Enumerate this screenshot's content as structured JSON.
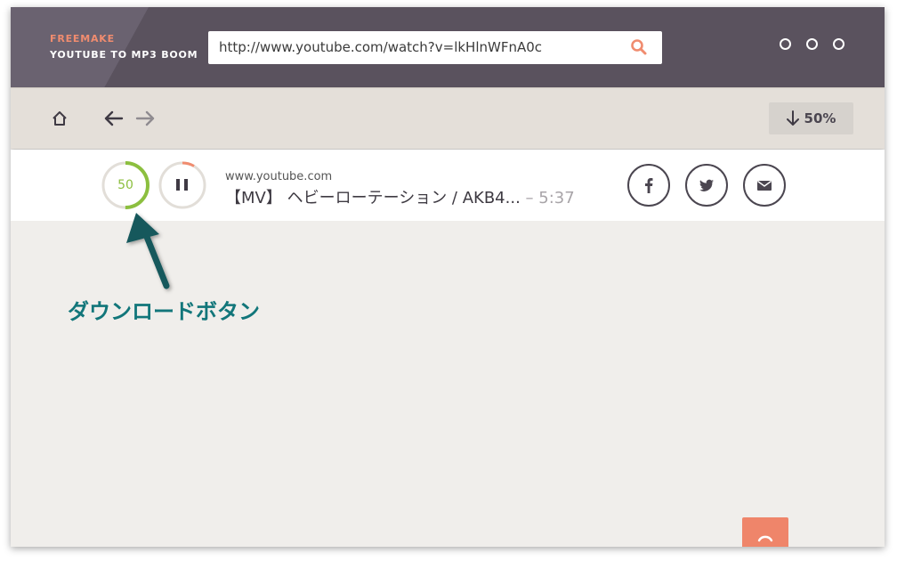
{
  "app": {
    "brand_top": "FREEMAKE",
    "brand_bottom": "YOUTUBE TO MP3 BOOM"
  },
  "search": {
    "url": "http://www.youtube.com/watch?v=lkHlnWFnA0c",
    "icon": "search-icon"
  },
  "toolbar": {
    "progress_label": "50%",
    "icons": [
      "home-icon",
      "back-arrow-icon",
      "forward-arrow-icon",
      "download-arrow-icon"
    ]
  },
  "item": {
    "download_progress": 50,
    "download_percent_label": "50",
    "domain": "www.youtube.com",
    "title": "【MV】 ヘビーローテーション / AKB4...",
    "duration": " – 5:37"
  },
  "social": [
    "facebook-icon",
    "twitter-icon",
    "mail-icon"
  ],
  "annotation": {
    "label": "ダウンロードボタン",
    "color": "#12767a"
  },
  "colors": {
    "header": "#5a525e",
    "accent": "#f08c6f",
    "progress_green": "#8cbf3f"
  }
}
